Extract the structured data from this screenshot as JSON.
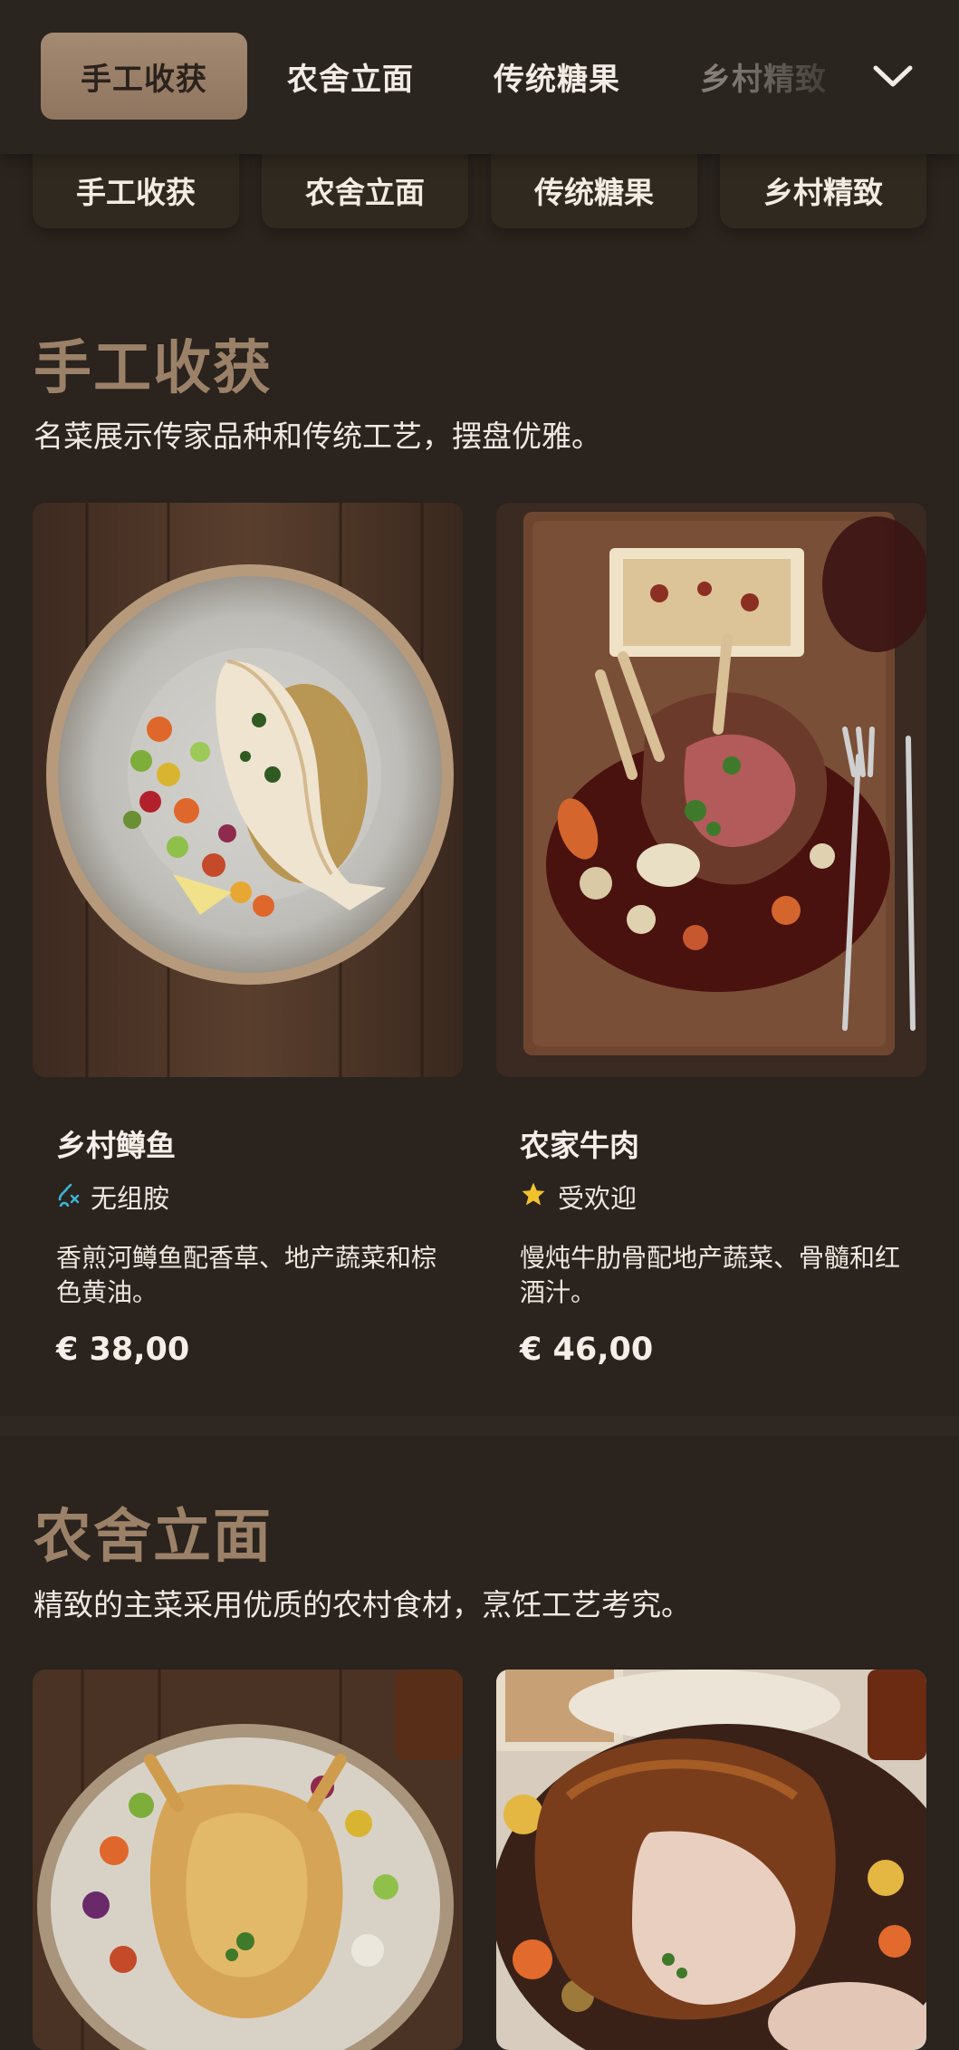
{
  "nav": {
    "tabs": [
      "手工收获",
      "农舍立面",
      "传统糖果",
      "乡村精致"
    ],
    "active_index": 0
  },
  "pills": [
    "手工收获",
    "农舍立面",
    "传统糖果",
    "乡村精致"
  ],
  "sections": [
    {
      "title": "手工收获",
      "subtitle": "名菜展示传家品种和传统工艺，摆盘优雅。",
      "items": [
        {
          "name": "乡村鳟鱼",
          "tag_icon": "no-histamine-icon",
          "tag": "无组胺",
          "description": "香煎河鳟鱼配香草、地产蔬菜和棕色黄油。",
          "price": "€ 38,00"
        },
        {
          "name": "农家牛肉",
          "tag_icon": "star-icon",
          "tag": "受欢迎",
          "description": "慢炖牛肋骨配地产蔬菜、骨髓和红酒汁。",
          "price": "€ 46,00"
        }
      ]
    },
    {
      "title": "农舍立面",
      "subtitle": "精致的主菜采用优质的农村食材，烹饪工艺考究。",
      "items": []
    }
  ],
  "colors": {
    "background": "#2a231e",
    "accent": "#9b8168",
    "active_tab": "#a58a72",
    "star": "#f2c12e",
    "histamine_icon": "#3cb5d6"
  }
}
